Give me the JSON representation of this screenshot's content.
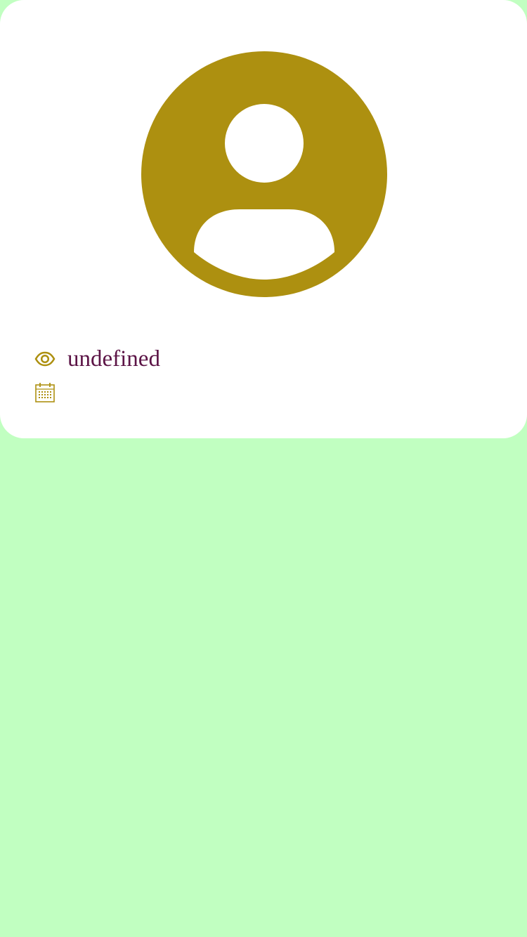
{
  "profile": {
    "avatar_icon": "user-avatar-icon",
    "views_icon": "eye-icon",
    "views_value": "undefined",
    "date_icon": "calendar-icon",
    "date_value": ""
  },
  "colors": {
    "background": "#c1ffc1",
    "card": "#ffffff",
    "accent": "#ad9010",
    "text": "#5c1446"
  }
}
